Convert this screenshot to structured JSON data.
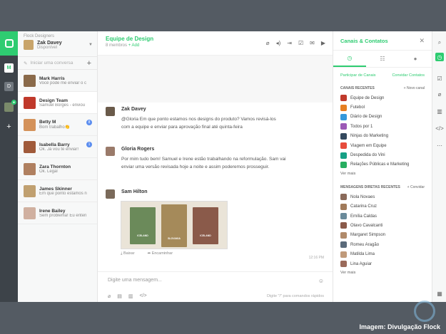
{
  "team": {
    "label": "Flock Designers",
    "user": "Zak Davey",
    "status": "Disponível"
  },
  "sidebar": {
    "start_label": "Iniciar uma conversa",
    "workspaces": [
      "M",
      "D"
    ],
    "conversations": [
      {
        "name": "Mark Harris",
        "msg": "Você pode me enviar o c",
        "color": "#8a6a4a",
        "badge": ""
      },
      {
        "name": "Design Team",
        "msg": "Samuel Borges - enviou",
        "color": "#c0392b",
        "badge": ""
      },
      {
        "name": "Betty M",
        "msg": "Bom trabalho👏",
        "color": "#d4925a",
        "badge": "8"
      },
      {
        "name": "Isabella Barry",
        "msg": "Ok. Já vou te enviar!",
        "color": "#a05a3a",
        "badge": "1"
      },
      {
        "name": "Zara Thornton",
        "msg": "Ok. Legal",
        "color": "#b08060",
        "badge": ""
      },
      {
        "name": "James Skinner",
        "msg": "Em que ponto estamos n",
        "color": "#c0a070",
        "badge": ""
      },
      {
        "name": "Irene Bailey",
        "msg": "Sem problema! Eu enten",
        "color": "#d0b0a0",
        "badge": ""
      }
    ]
  },
  "chat": {
    "title": "Equipe de Design",
    "members": "8 membros",
    "add": "+ Add",
    "messages": [
      {
        "author": "Zak Davey",
        "text": "@Gloria  Em que ponto estamos nos designs do produto? Vamos revisá-los com a equipe e enviar para aprovação final até quinta-feira",
        "color": "#6a5a4a"
      },
      {
        "author": "Gloria Rogers",
        "text": "Por mim tudo bem! Samuel e Irene estão trabalhando na reformulação. Sam vai enviar uma versão revisada hoje a noite e assim poderemos prosseguir.",
        "color": "#9a7a6a"
      },
      {
        "author": "Sam Hilton",
        "text": "",
        "color": "#7a6a5a"
      }
    ],
    "image_labels": [
      "ICELAND",
      "SLOVAKIA",
      "ICELAND"
    ],
    "download": "Baixar",
    "forward": "Encaminhar",
    "time": "12:16 PM",
    "placeholder": "Digite uma mensagem...",
    "hint": "Digite \"/\" para comandos rápidos"
  },
  "panel": {
    "title": "Canais & Contatos",
    "join": "Participar de Canais",
    "invite": "Convidar Contatos",
    "channels_header": "Canais recentes",
    "new_channel": "+ Novo canal",
    "channels": [
      {
        "name": "Equipe de Design",
        "color": "#c0392b"
      },
      {
        "name": "Futebol",
        "color": "#e67e22"
      },
      {
        "name": "Diário de Design",
        "color": "#3498db"
      },
      {
        "name": "Todos por 1",
        "color": "#9b59b6"
      },
      {
        "name": "Ninjas do Marketing",
        "color": "#34495e"
      },
      {
        "name": "Viagem em Equipe",
        "color": "#e74c3c"
      },
      {
        "name": "Despedida do Vini",
        "color": "#16a085"
      },
      {
        "name": "Relações Públicas e Marketing",
        "color": "#27ae60"
      }
    ],
    "see_more_1": "Ver mais",
    "dm_header": "Mensagens diretas recentes",
    "dm_action": "+ Convidar",
    "dms": [
      {
        "name": "Nola Novaes",
        "color": "#8a6a5a"
      },
      {
        "name": "Catarina Cruz",
        "color": "#a07a5a"
      },
      {
        "name": "Emília Caldas",
        "color": "#6a8a9a"
      },
      {
        "name": "Olavo Cavalcanti",
        "color": "#8a5a4a"
      },
      {
        "name": "Margaret Simpson",
        "color": "#b08a6a"
      },
      {
        "name": "Romeu Aragão",
        "color": "#5a6a7a"
      },
      {
        "name": "Matilda Lima",
        "color": "#c09a7a"
      },
      {
        "name": "Lina Aguiar",
        "color": "#9a6a5a"
      }
    ],
    "see_more_2": "Ver mais"
  },
  "caption": "Imagem: Divulgação Flock",
  "colors": {
    "accent": "#2ecc71",
    "rail": "#3d4349",
    "background": "#545b63"
  }
}
